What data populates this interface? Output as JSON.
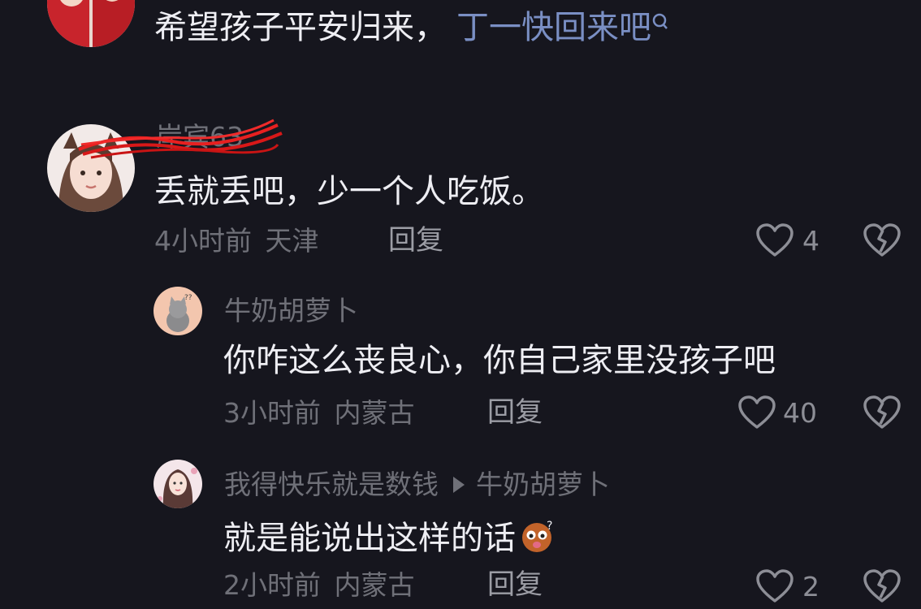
{
  "comments": [
    {
      "text": "希望孩子平安归来，",
      "link_text": "丁一快回来吧"
    },
    {
      "username": "岸宾63",
      "text": "丢就丢吧，少一个人吃饭。",
      "time": "4小时前",
      "location": "天津",
      "reply_label": "回复",
      "likes": "4"
    }
  ],
  "replies": [
    {
      "username": "牛奶胡萝卜",
      "text": "你咋这么丧良心，你自己家里没孩子吧",
      "time": "3小时前",
      "location": "内蒙古",
      "reply_label": "回复",
      "likes": "40"
    },
    {
      "username": "我得快乐就是数钱",
      "reply_to": "牛奶胡萝卜",
      "text": "就是能说出这样的话",
      "time": "2小时前",
      "location": "内蒙古",
      "reply_label": "回复",
      "likes": "2"
    }
  ],
  "colors": {
    "background": "#16161e",
    "text": "#eeeef3",
    "muted": "#6f7078",
    "link": "#7a8fc4"
  },
  "icons": [
    "search-icon",
    "heart-icon",
    "dislike-icon",
    "emoji-icon"
  ]
}
